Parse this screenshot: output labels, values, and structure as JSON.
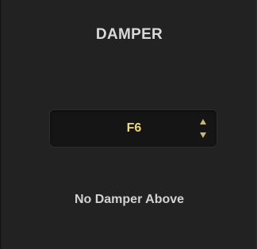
{
  "panel": {
    "title": "DAMPER",
    "note_select": {
      "value": "F6",
      "up_icon": "chevron-up-icon",
      "down_icon": "chevron-down-icon"
    },
    "status": "No Damper Above"
  },
  "colors": {
    "accent": "#f0d878",
    "background": "#222222",
    "text": "#d9d9d9"
  }
}
